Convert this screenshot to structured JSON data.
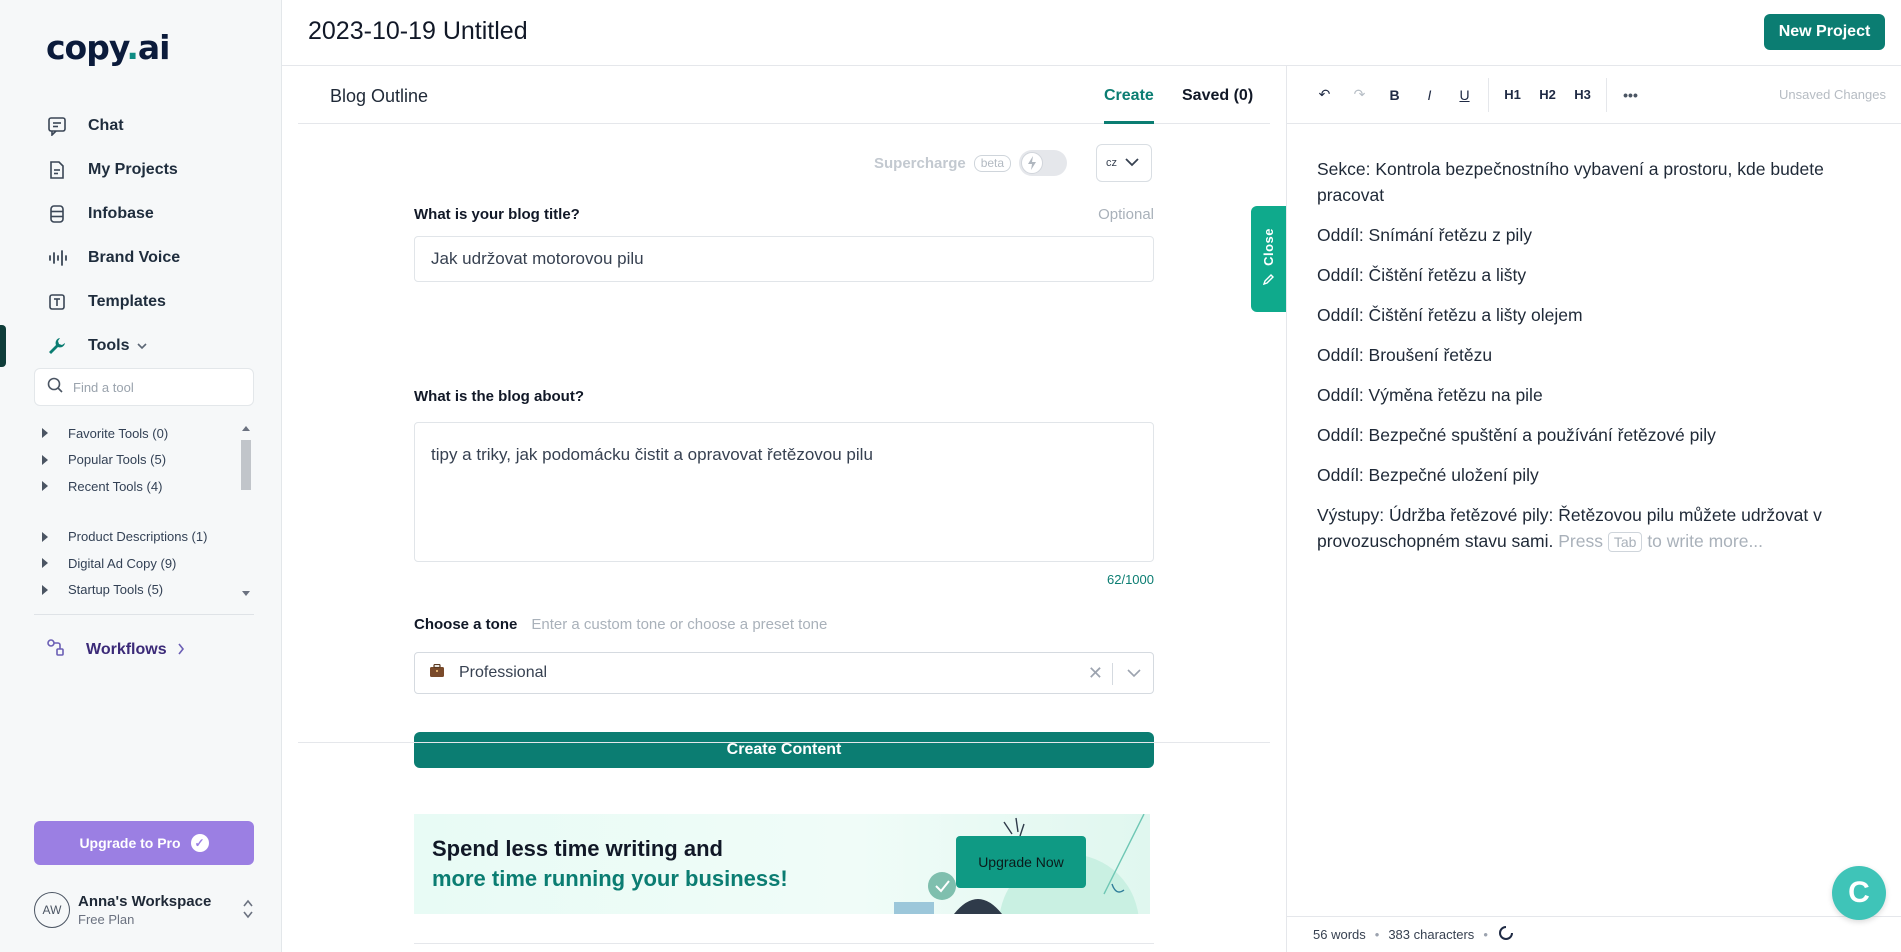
{
  "brand": {
    "logo_main": "copy",
    "logo_dot": ".",
    "logo_tail": "ai"
  },
  "sidebar": {
    "nav": [
      {
        "label": "Chat",
        "icon": "chat-icon"
      },
      {
        "label": "My Projects",
        "icon": "file-icon"
      },
      {
        "label": "Infobase",
        "icon": "database-icon"
      },
      {
        "label": "Brand Voice",
        "icon": "soundwave-icon"
      },
      {
        "label": "Templates",
        "icon": "template-icon"
      },
      {
        "label": "Tools",
        "icon": "wrench-icon"
      }
    ],
    "tool_search_placeholder": "Find a tool",
    "tool_groups": [
      "Favorite Tools (0)",
      "Popular Tools (5)",
      "Recent Tools (4)",
      "Product Descriptions (1)",
      "Digital Ad Copy (9)",
      "Startup Tools (5)"
    ],
    "workflows_label": "Workflows",
    "upgrade_label": "Upgrade to Pro",
    "workspace": {
      "initials": "AW",
      "name": "Anna's Workspace",
      "plan": "Free Plan"
    }
  },
  "header": {
    "doc_title": "2023-10-19 Untitled",
    "new_project_label": "New Project"
  },
  "tool_panel": {
    "tool_name": "Blog Outline",
    "tabs": {
      "create": "Create",
      "saved": "Saved (0)"
    },
    "supercharge": {
      "label": "Supercharge",
      "badge": "beta",
      "enabled": false
    },
    "language": "cz",
    "fields": {
      "title_label": "What is your blog title?",
      "title_optional": "Optional",
      "title_value": "Jak udržovat motorovou pilu",
      "about_label": "What is the blog about?",
      "about_value": "tipy a triky, jak podomácku čistit a opravovat řetězovou pilu",
      "about_counter": "62/1000",
      "tone_label": "Choose a tone",
      "tone_hint": "Enter a custom tone or choose a preset tone",
      "tone_value": "Professional",
      "tone_icon": "briefcase-icon"
    },
    "create_label": "Create Content",
    "promo": {
      "line1": "Spend less time writing and",
      "line2": "more time running your business!",
      "button": "Upgrade Now"
    },
    "close_tab_label": "Close"
  },
  "editor": {
    "toolbar": [
      "↶",
      "↷",
      "B",
      "I",
      "U",
      "H1",
      "H2",
      "H3",
      "•••"
    ],
    "unsaved_label": "Unsaved Changes",
    "paragraphs": [
      "Sekce: Kontrola bezpečnostního vybavení a prostoru, kde budete pracovat",
      "Oddíl: Snímání řetězu z pily",
      "Oddíl: Čištění řetězu a lišty",
      "Oddíl: Čištění řetězu a lišty olejem",
      "Oddíl: Broušení řetězu",
      "Oddíl: Výměna řetězu na pile",
      "Oddíl: Bezpečné spuštění a používání řetězové pily",
      "Oddíl: Bezpečné uložení pily"
    ],
    "last_paragraph": "Výstupy: Údržba řetězové pily: Řetězovou pilu můžete udržovat v provozuschopném stavu sami.",
    "hint_press": "Press",
    "hint_key": "Tab",
    "hint_rest": "to write more...",
    "status": {
      "words": "56 words",
      "characters": "383 characters"
    }
  },
  "colors": {
    "accent": "#0b7d72",
    "purple": "#9b7fe3",
    "close_tab": "#0faa8c"
  }
}
